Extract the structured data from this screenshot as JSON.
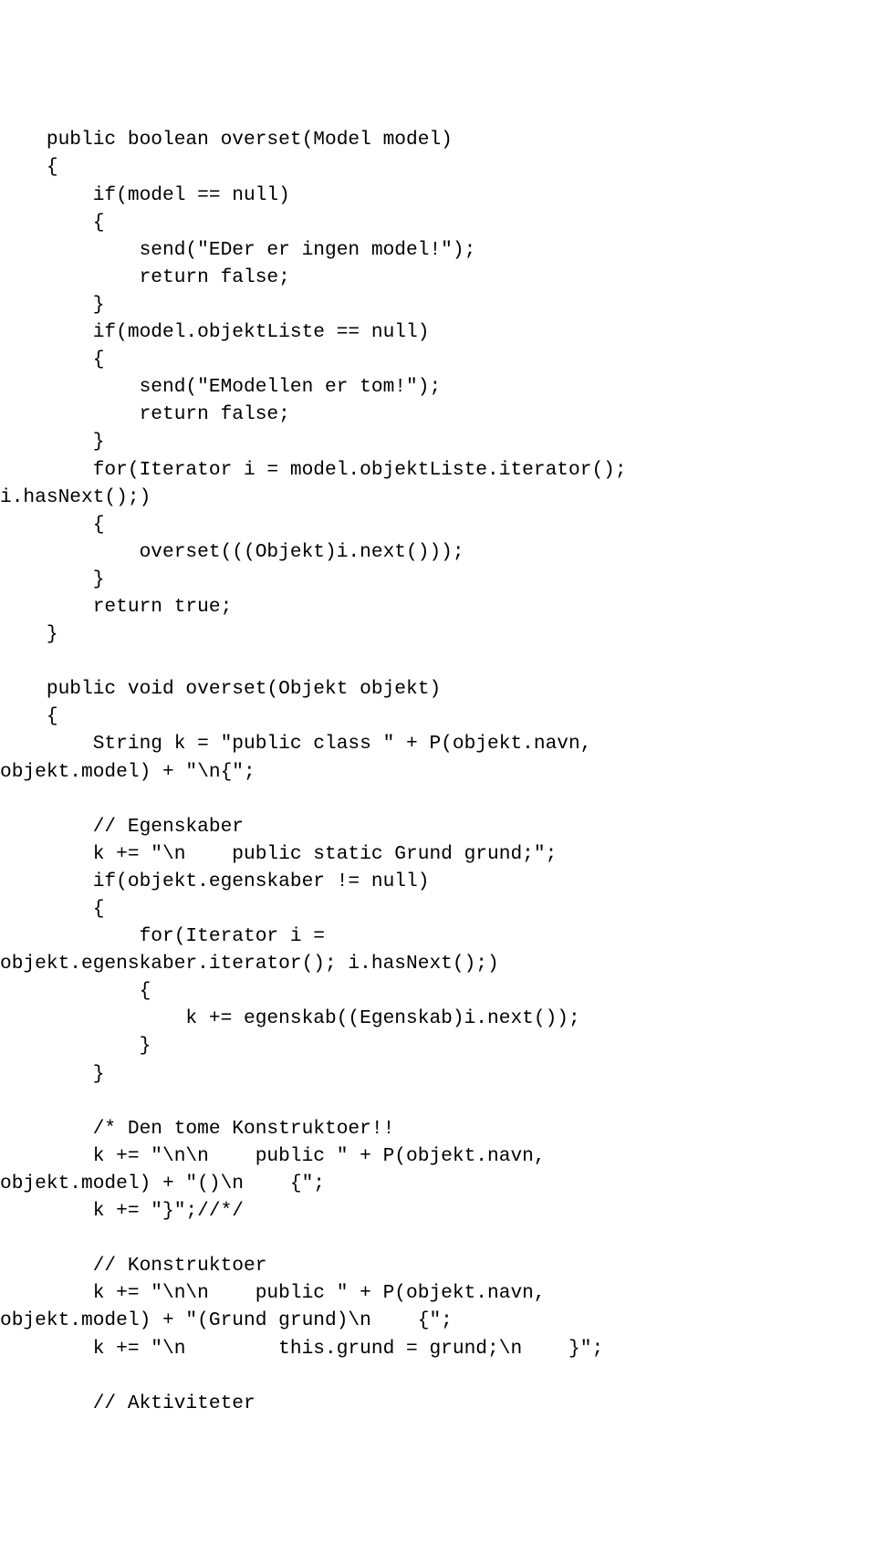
{
  "code": "    public boolean overset(Model model)\n    {\n        if(model == null)\n        {\n            send(\"EDer er ingen model!\");\n            return false;\n        }\n        if(model.objektListe == null)\n        {\n            send(\"EModellen er tom!\");\n            return false;\n        }\n        for(Iterator i = model.objektListe.iterator();\ni.hasNext();)\n        {\n            overset(((Objekt)i.next()));\n        }\n        return true;\n    }\n\n    public void overset(Objekt objekt)\n    {\n        String k = \"public class \" + P(objekt.navn,\nobjekt.model) + \"\\n{\";\n\n        // Egenskaber\n        k += \"\\n    public static Grund grund;\";\n        if(objekt.egenskaber != null)\n        {\n            for(Iterator i =\nobjekt.egenskaber.iterator(); i.hasNext();)\n            {\n                k += egenskab((Egenskab)i.next());\n            }\n        }\n\n        /* Den tome Konstruktoer!!\n        k += \"\\n\\n    public \" + P(objekt.navn,\nobjekt.model) + \"()\\n    {\";\n        k += \"}\";//*/\n\n        // Konstruktoer\n        k += \"\\n\\n    public \" + P(objekt.navn,\nobjekt.model) + \"(Grund grund)\\n    {\";\n        k += \"\\n        this.grund = grund;\\n    }\";\n\n        // Aktiviteter"
}
